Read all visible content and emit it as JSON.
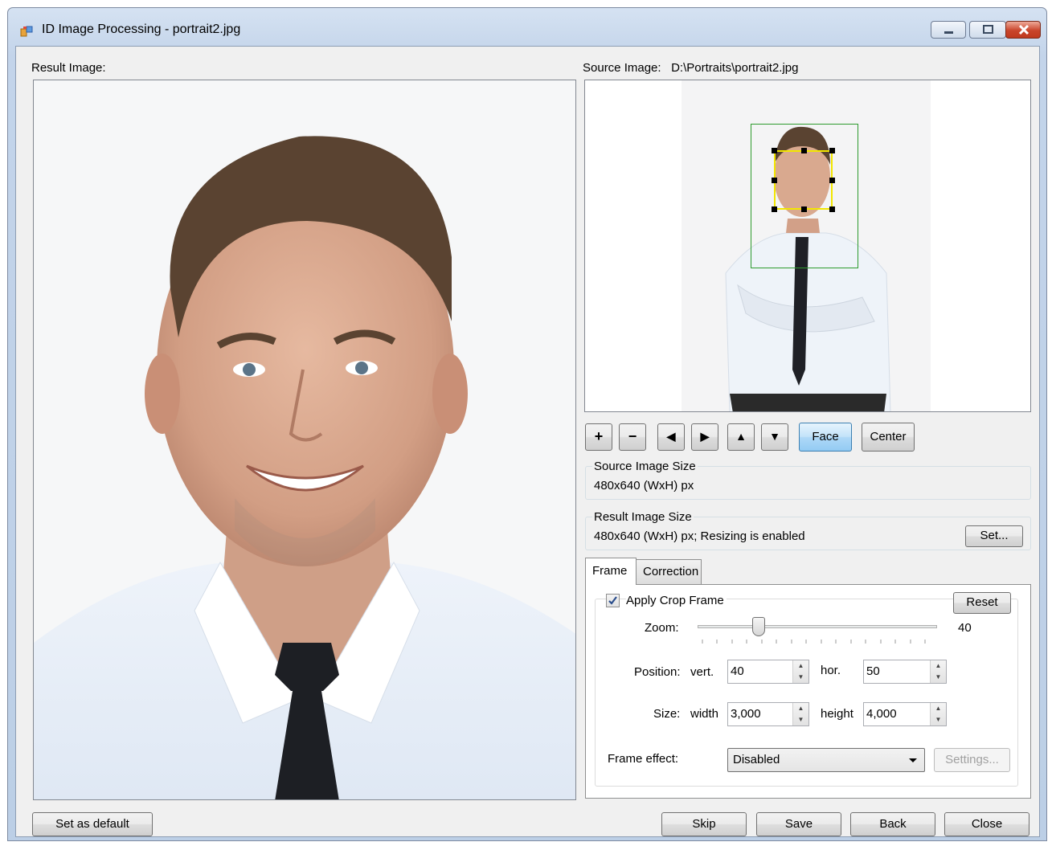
{
  "window": {
    "title": "ID Image Processing - portrait2.jpg",
    "icon": "app-icon",
    "controls": [
      "minimize-icon",
      "maximize-icon",
      "close-icon"
    ]
  },
  "result_panel": {
    "label": "Result Image:"
  },
  "source_panel": {
    "label": "Source Image:",
    "path": "D:\\Portraits\\portrait2.jpg"
  },
  "nav_buttons": {
    "zoom_in": "+",
    "zoom_out": "−",
    "left": "◀",
    "right": "▶",
    "up": "▲",
    "down": "▼",
    "face": "Face",
    "center": "Center"
  },
  "source_size": {
    "title": "Source Image Size",
    "value": "480x640 (WxH) px"
  },
  "result_size": {
    "title": "Result Image Size",
    "value": "480x640 (WxH) px; Resizing is enabled",
    "set_button": "Set..."
  },
  "tabs": {
    "frame": "Frame",
    "correction": "Correction",
    "active": "Frame"
  },
  "frame": {
    "apply_crop_label": "Apply Crop Frame",
    "apply_crop_checked": true,
    "reset_button": "Reset",
    "zoom_label": "Zoom:",
    "zoom_value": "40",
    "position_label": "Position:",
    "vert_label": "vert.",
    "vert_value": "40",
    "hor_label": "hor.",
    "hor_value": "50",
    "size_label": "Size:",
    "width_label": "width",
    "width_value": "3,000",
    "height_label": "height",
    "height_value": "4,000",
    "effect_label": "Frame effect:",
    "effect_value": "Disabled",
    "settings_button": "Settings..."
  },
  "footer": {
    "set_default": "Set as default",
    "skip": "Skip",
    "save": "Save",
    "back": "Back",
    "close": "Close"
  },
  "colors": {
    "face_button_accent": "#93cbf3",
    "crop_frame": "#2e9b2e",
    "face_box": "#f2e600"
  }
}
